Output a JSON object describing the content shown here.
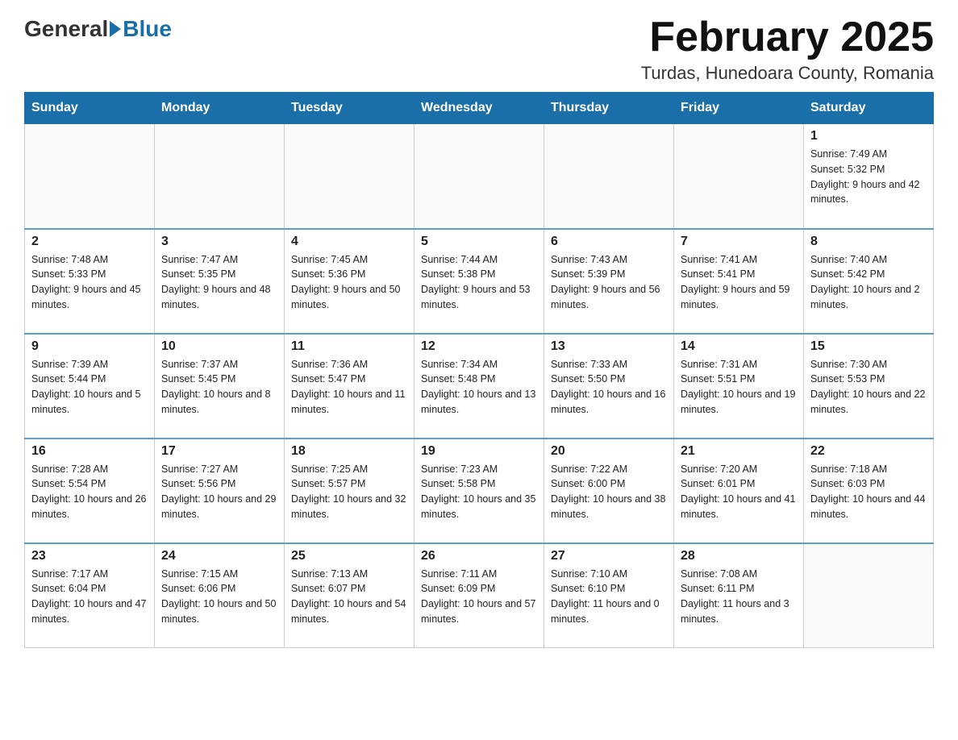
{
  "header": {
    "logo_general": "General",
    "logo_blue": "Blue",
    "month_year": "February 2025",
    "location": "Turdas, Hunedoara County, Romania"
  },
  "days_of_week": [
    "Sunday",
    "Monday",
    "Tuesday",
    "Wednesday",
    "Thursday",
    "Friday",
    "Saturday"
  ],
  "weeks": [
    [
      {
        "day": "",
        "info": ""
      },
      {
        "day": "",
        "info": ""
      },
      {
        "day": "",
        "info": ""
      },
      {
        "day": "",
        "info": ""
      },
      {
        "day": "",
        "info": ""
      },
      {
        "day": "",
        "info": ""
      },
      {
        "day": "1",
        "info": "Sunrise: 7:49 AM\nSunset: 5:32 PM\nDaylight: 9 hours and 42 minutes."
      }
    ],
    [
      {
        "day": "2",
        "info": "Sunrise: 7:48 AM\nSunset: 5:33 PM\nDaylight: 9 hours and 45 minutes."
      },
      {
        "day": "3",
        "info": "Sunrise: 7:47 AM\nSunset: 5:35 PM\nDaylight: 9 hours and 48 minutes."
      },
      {
        "day": "4",
        "info": "Sunrise: 7:45 AM\nSunset: 5:36 PM\nDaylight: 9 hours and 50 minutes."
      },
      {
        "day": "5",
        "info": "Sunrise: 7:44 AM\nSunset: 5:38 PM\nDaylight: 9 hours and 53 minutes."
      },
      {
        "day": "6",
        "info": "Sunrise: 7:43 AM\nSunset: 5:39 PM\nDaylight: 9 hours and 56 minutes."
      },
      {
        "day": "7",
        "info": "Sunrise: 7:41 AM\nSunset: 5:41 PM\nDaylight: 9 hours and 59 minutes."
      },
      {
        "day": "8",
        "info": "Sunrise: 7:40 AM\nSunset: 5:42 PM\nDaylight: 10 hours and 2 minutes."
      }
    ],
    [
      {
        "day": "9",
        "info": "Sunrise: 7:39 AM\nSunset: 5:44 PM\nDaylight: 10 hours and 5 minutes."
      },
      {
        "day": "10",
        "info": "Sunrise: 7:37 AM\nSunset: 5:45 PM\nDaylight: 10 hours and 8 minutes."
      },
      {
        "day": "11",
        "info": "Sunrise: 7:36 AM\nSunset: 5:47 PM\nDaylight: 10 hours and 11 minutes."
      },
      {
        "day": "12",
        "info": "Sunrise: 7:34 AM\nSunset: 5:48 PM\nDaylight: 10 hours and 13 minutes."
      },
      {
        "day": "13",
        "info": "Sunrise: 7:33 AM\nSunset: 5:50 PM\nDaylight: 10 hours and 16 minutes."
      },
      {
        "day": "14",
        "info": "Sunrise: 7:31 AM\nSunset: 5:51 PM\nDaylight: 10 hours and 19 minutes."
      },
      {
        "day": "15",
        "info": "Sunrise: 7:30 AM\nSunset: 5:53 PM\nDaylight: 10 hours and 22 minutes."
      }
    ],
    [
      {
        "day": "16",
        "info": "Sunrise: 7:28 AM\nSunset: 5:54 PM\nDaylight: 10 hours and 26 minutes."
      },
      {
        "day": "17",
        "info": "Sunrise: 7:27 AM\nSunset: 5:56 PM\nDaylight: 10 hours and 29 minutes."
      },
      {
        "day": "18",
        "info": "Sunrise: 7:25 AM\nSunset: 5:57 PM\nDaylight: 10 hours and 32 minutes."
      },
      {
        "day": "19",
        "info": "Sunrise: 7:23 AM\nSunset: 5:58 PM\nDaylight: 10 hours and 35 minutes."
      },
      {
        "day": "20",
        "info": "Sunrise: 7:22 AM\nSunset: 6:00 PM\nDaylight: 10 hours and 38 minutes."
      },
      {
        "day": "21",
        "info": "Sunrise: 7:20 AM\nSunset: 6:01 PM\nDaylight: 10 hours and 41 minutes."
      },
      {
        "day": "22",
        "info": "Sunrise: 7:18 AM\nSunset: 6:03 PM\nDaylight: 10 hours and 44 minutes."
      }
    ],
    [
      {
        "day": "23",
        "info": "Sunrise: 7:17 AM\nSunset: 6:04 PM\nDaylight: 10 hours and 47 minutes."
      },
      {
        "day": "24",
        "info": "Sunrise: 7:15 AM\nSunset: 6:06 PM\nDaylight: 10 hours and 50 minutes."
      },
      {
        "day": "25",
        "info": "Sunrise: 7:13 AM\nSunset: 6:07 PM\nDaylight: 10 hours and 54 minutes."
      },
      {
        "day": "26",
        "info": "Sunrise: 7:11 AM\nSunset: 6:09 PM\nDaylight: 10 hours and 57 minutes."
      },
      {
        "day": "27",
        "info": "Sunrise: 7:10 AM\nSunset: 6:10 PM\nDaylight: 11 hours and 0 minutes."
      },
      {
        "day": "28",
        "info": "Sunrise: 7:08 AM\nSunset: 6:11 PM\nDaylight: 11 hours and 3 minutes."
      },
      {
        "day": "",
        "info": ""
      }
    ]
  ]
}
